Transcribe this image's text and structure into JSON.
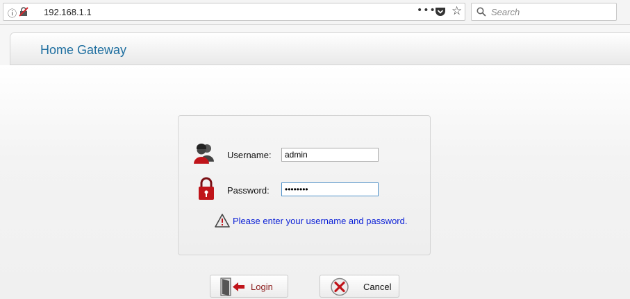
{
  "browser": {
    "url": "192.168.1.1",
    "more_label": "•••",
    "search_placeholder": "Search",
    "info_glyph": "ⓘ",
    "star_glyph": "☆"
  },
  "header": {
    "title": "Home Gateway"
  },
  "login": {
    "username_label": "Username:",
    "username_value": "admin",
    "password_label": "Password:",
    "password_value": "••••••••",
    "message": "Please enter your username and password.",
    "login_label": "Login",
    "cancel_label": "Cancel"
  },
  "colors": {
    "title": "#1f6fa0",
    "message": "#0a1fd6",
    "login_text": "#8b1a1a",
    "icon_red": "#c0141a"
  },
  "icons": [
    "info-icon",
    "tracking-off-icon",
    "more-icon",
    "pocket-icon",
    "bookmark-star-icon",
    "search-icon",
    "user-icon",
    "lock-icon",
    "warning-icon",
    "login-door-icon",
    "cancel-x-icon"
  ]
}
